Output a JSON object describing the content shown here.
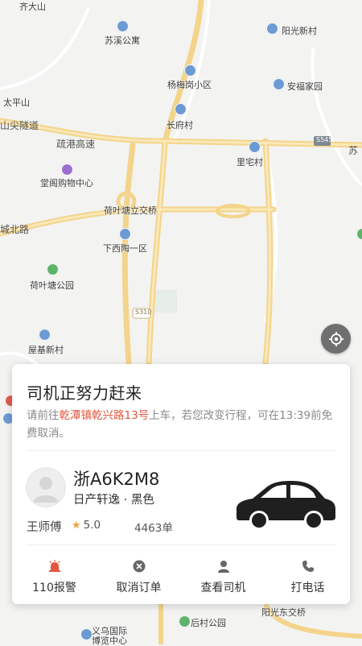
{
  "map": {
    "labels": {
      "qidashan": "齐大山",
      "suxi": "苏溪公寓",
      "yangguang_top": "阳光新村",
      "yangmeigang": "杨梅岗小区",
      "anfujiayuan": "安福家园",
      "taipingshan": "太平山",
      "changfu": "长府村",
      "tunnel": "山尖隧道",
      "shugang": "疏港高速",
      "s545": "S545",
      "su": "苏",
      "lizhai": "里宅村",
      "tangge": "堂阁购物中心",
      "heyetang_jq": "荷叶塘立交桥",
      "chengbei": "城北路",
      "xiaxitao": "下西陶一区",
      "heyetang_park": "荷叶塘公园",
      "s310": "S310",
      "wuji": "屋基新村",
      "yiwu": "义乌国际\n博览中心",
      "houcun_park": "后村公园",
      "yangguang_jq": "阳光东交桥"
    }
  },
  "card": {
    "title": "司机正努力赶来",
    "desc_prefix": "请前往",
    "destination": "乾潭镇乾兴路13号",
    "desc_suffix": "上车，若您改变行程，可在13:39前免费取消。",
    "plate": "浙A6K2M8",
    "car_model": "日产轩逸 · 黑色",
    "driver_name": "王师傅",
    "rating": "5.0",
    "orders": "4463单"
  },
  "actions": [
    {
      "label": "110报警",
      "icon": "alarm-icon"
    },
    {
      "label": "取消订单",
      "icon": "cancel-icon"
    },
    {
      "label": "查看司机",
      "icon": "driver-icon"
    },
    {
      "label": "打电话",
      "icon": "phone-icon"
    }
  ],
  "colors": {
    "accent": "#e2553f",
    "star": "#f2a23a",
    "road_major": "#f7d98a",
    "locate_button": "#6f6f6f"
  }
}
